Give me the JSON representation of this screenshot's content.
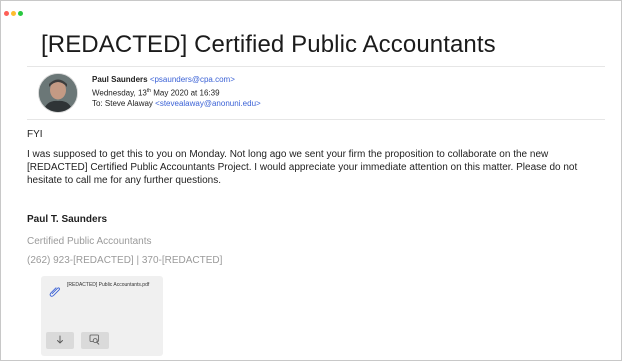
{
  "subject": "[REDACTED] Certified Public Accountants",
  "header": {
    "from_name": "Paul Saunders",
    "from_email": "<psaunders@cpa.com>",
    "date_prefix": "Wednesday, 13",
    "date_ordinal": "th",
    "date_suffix": " May 2020 at 16:39",
    "to_prefix": "To: Steve Alaway ",
    "to_email": "<stevealaway@anonuni.edu>"
  },
  "body": {
    "greeting": "FYI",
    "paragraph": "I was supposed to get this to you on Monday. Not long ago we sent your firm the proposition to collaborate on the new [REDACTED] Certified Public Accountants Project. I would appreciate your immediate attention on this matter. Please do not hesitate to call me for any further questions."
  },
  "signature": {
    "name": "Paul T. Saunders",
    "title": "Certified Public Accountants",
    "phone": "(262) 923-[REDACTED] | 370-[REDACTED]"
  },
  "attachment": {
    "filename": "[REDACTED] Public Accountants.pdf",
    "icons": [
      "paperclip-icon",
      "download-icon",
      "quicklook-icon"
    ]
  },
  "colors": {
    "link": "#3b62d6",
    "muted": "#9a9a9a",
    "close": "#fe5f57",
    "minimize": "#febc2e",
    "zoom": "#28c840"
  }
}
